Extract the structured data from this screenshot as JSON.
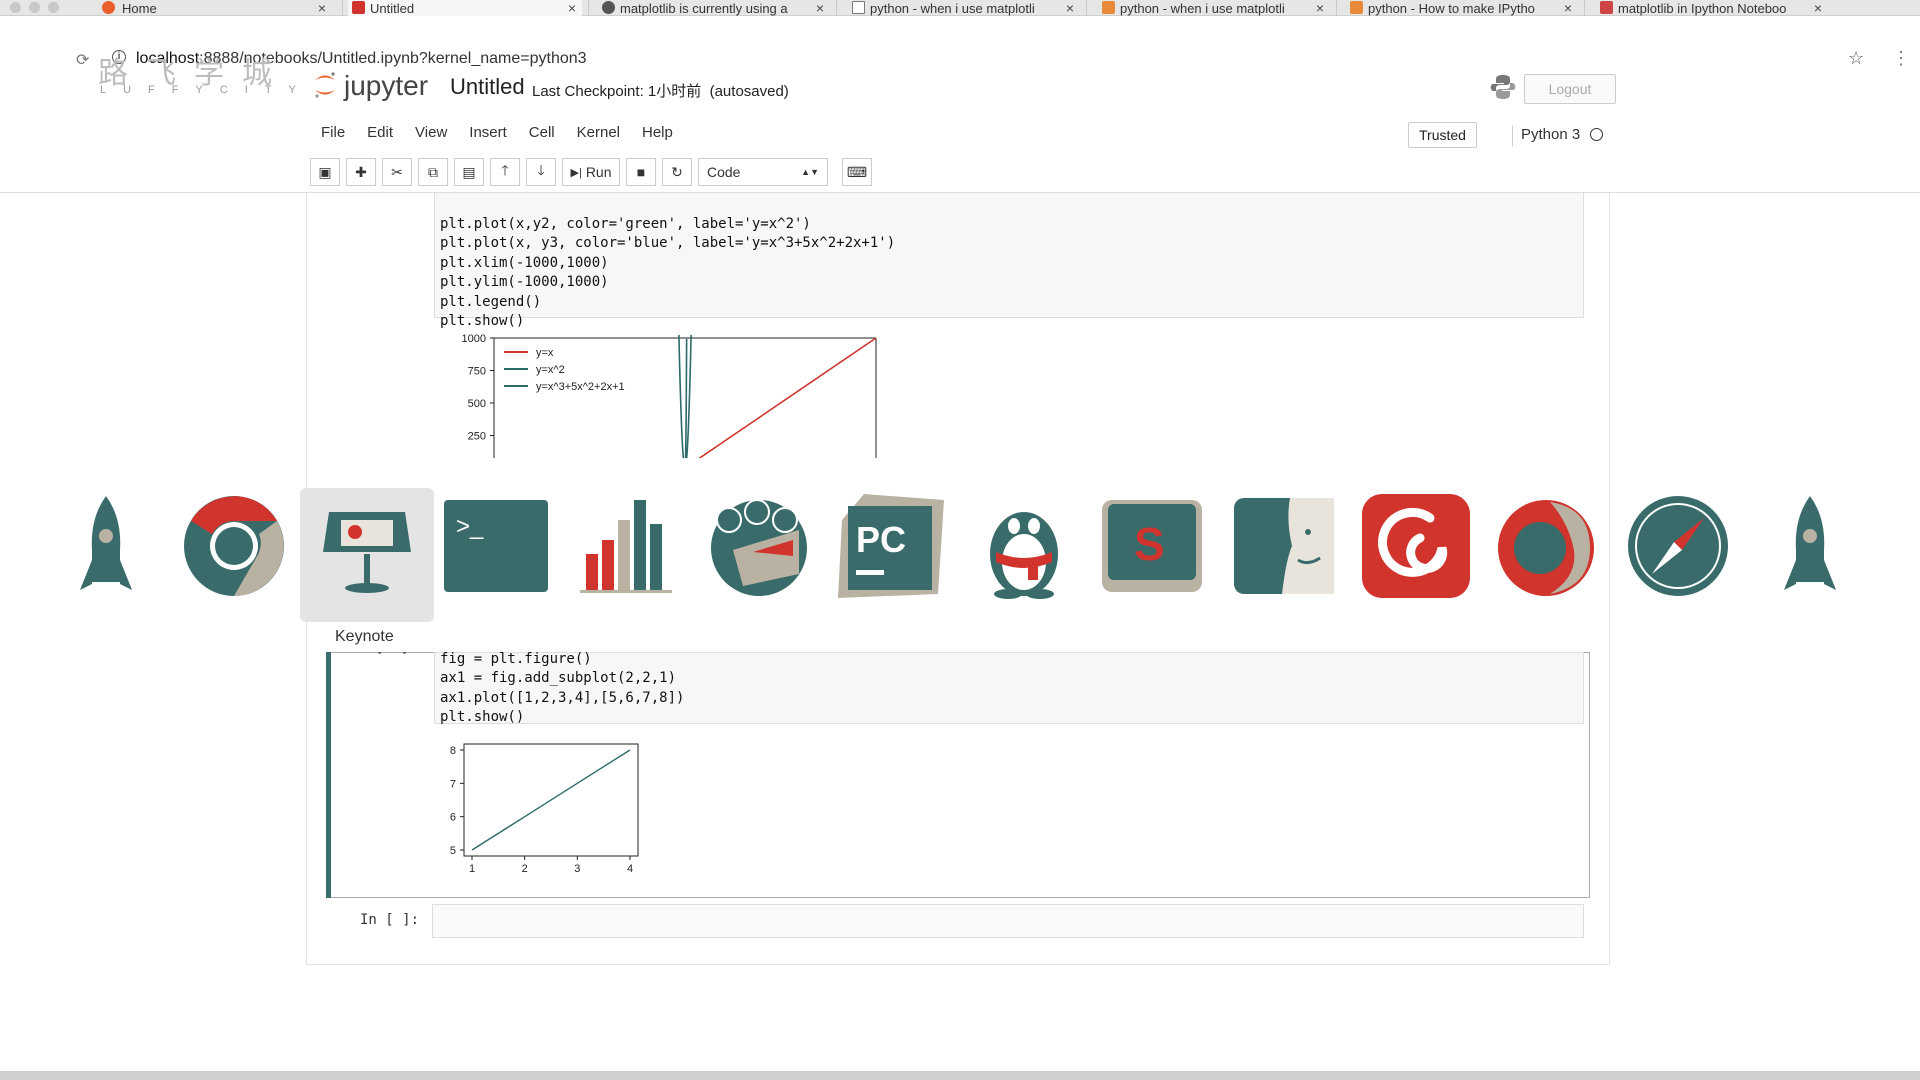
{
  "tabs": [
    {
      "label": "Home",
      "icon": "jupyter-icon"
    },
    {
      "label": "Untitled",
      "icon": "notebook-icon"
    },
    {
      "label": "matplotlib is currently using a",
      "icon": "github-icon"
    },
    {
      "label": "python - when i use matplotli",
      "icon": "document-icon"
    },
    {
      "label": "python - when i use matplotli",
      "icon": "stackoverflow-icon"
    },
    {
      "label": "python - How to make IPytho",
      "icon": "stackoverflow-icon"
    },
    {
      "label": "matplotlib in Ipython Noteboo",
      "icon": "page-icon"
    }
  ],
  "address": {
    "host": "localhost",
    "rest": ":8888/notebooks/Untitled.ipynb?kernel_name=python3"
  },
  "watermark": {
    "title": "路飞学城",
    "subtitle": "LUFFYCITY"
  },
  "header": {
    "brand": "jupyter",
    "notebook_title": "Untitled",
    "checkpoint": "Last Checkpoint: 1小时前",
    "autosave": "(autosaved)",
    "logout": "Logout"
  },
  "menu": [
    "File",
    "Edit",
    "View",
    "Insert",
    "Cell",
    "Kernel",
    "Help"
  ],
  "status": {
    "trusted": "Trusted",
    "kernel": "Python 3"
  },
  "toolbar": {
    "run": "Run",
    "cell_type": "Code"
  },
  "cell1": {
    "code": [
      "plt.plot(x,y2, color='green', label='y=x^2')",
      "plt.plot(x, y3, color='blue', label='y=x^3+5x^2+2x+1')",
      "plt.xlim(-1000,1000)",
      "plt.ylim(-1000,1000)",
      "plt.legend()",
      "plt.show()"
    ]
  },
  "chart_data": [
    {
      "type": "line",
      "ylim": [
        -1000,
        1000
      ],
      "yticks": [
        "1000",
        "750",
        "500",
        "250"
      ],
      "legend": [
        "y=x",
        "y=x^2",
        "y=x^3+5x^2+2x+1"
      ],
      "legend_position": "top-left",
      "series": [
        {
          "name": "y=x",
          "color": "#d0342c",
          "x": [
            -1000,
            1000
          ],
          "y": [
            -1000,
            1000
          ]
        },
        {
          "name": "y=x^2",
          "color": "#2d6a6a"
        },
        {
          "name": "y=x^3+5x^2+2x+1",
          "color": "#2d6a6a"
        }
      ]
    },
    {
      "type": "line",
      "x": [
        1,
        2,
        3,
        4
      ],
      "y": [
        5,
        6,
        7,
        8
      ],
      "xticks": [
        "1",
        "2",
        "3",
        "4"
      ],
      "yticks": [
        "5",
        "6",
        "7",
        "8"
      ],
      "xlim": [
        1,
        4
      ],
      "ylim": [
        5,
        8
      ]
    }
  ],
  "cell2": {
    "prompt": "In [94]:",
    "code": [
      "fig = plt.figure()",
      "ax1 = fig.add_subplot(2,2,1)",
      "ax1.plot([1,2,3,4],[5,6,7,8])",
      "plt.show()"
    ]
  },
  "cell3": {
    "prompt": "In [ ]:"
  },
  "dock": {
    "apps": [
      "rocket-app",
      "chrome-app",
      "keynote-app",
      "terminal-app",
      "charts-app",
      "photos-app",
      "pycharm-app",
      "qq-app",
      "sublime-app",
      "finder-app",
      "netease-music-app",
      "firefox-app",
      "safari-app",
      "rocket-app"
    ],
    "hover_label": "Keynote"
  }
}
